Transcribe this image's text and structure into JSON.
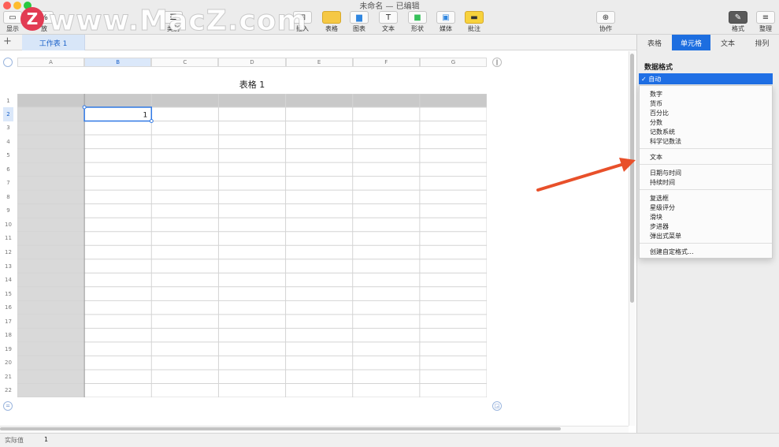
{
  "window": {
    "title": "未命名 — 已编辑"
  },
  "toolbar": {
    "left": [
      {
        "id": "view",
        "label": "显示"
      },
      {
        "id": "zoom",
        "label": "放",
        "value": "%"
      },
      {
        "id": "add-category",
        "label": "类别"
      }
    ],
    "center": [
      {
        "id": "insert",
        "label": "插入",
        "icon": "insert-icon"
      },
      {
        "id": "table",
        "label": "表格",
        "icon": "table-icon"
      },
      {
        "id": "chart",
        "label": "图表",
        "icon": "chart-icon"
      },
      {
        "id": "text",
        "label": "文本",
        "icon": "text-icon"
      },
      {
        "id": "shape",
        "label": "形状",
        "icon": "shape-icon"
      },
      {
        "id": "media",
        "label": "媒体",
        "icon": "media-icon"
      },
      {
        "id": "comment",
        "label": "批注",
        "icon": "comment-icon"
      }
    ],
    "collaborate": "协作",
    "format": "格式",
    "organize": "整理"
  },
  "watermark": {
    "logo_letter": "Z",
    "text": "www.MacZ.com"
  },
  "sheets": {
    "active": "工作表 1"
  },
  "table": {
    "title": "表格 1",
    "columns": [
      "A",
      "B",
      "C",
      "D",
      "E",
      "F",
      "G"
    ],
    "rows": [
      "1",
      "2",
      "3",
      "4",
      "5",
      "6",
      "7",
      "8",
      "9",
      "10",
      "11",
      "12",
      "13",
      "14",
      "15",
      "16",
      "17",
      "18",
      "19",
      "20",
      "21",
      "22"
    ],
    "selected_cell": {
      "col": "B",
      "row": "2",
      "value": "1"
    }
  },
  "inspector": {
    "tabs": [
      "表格",
      "单元格",
      "文本",
      "排列"
    ],
    "active_tab": "单元格",
    "section_title": "数据格式",
    "selected_format": "✓ 自动",
    "menu_groups": [
      [
        "数字",
        "货币",
        "百分比",
        "分数",
        "记数系统",
        "科学记数法"
      ],
      [
        "文本"
      ],
      [
        "日期与时间",
        "持续时间"
      ],
      [
        "复选框",
        "星级评分",
        "滑块",
        "步进器",
        "弹出式菜单"
      ],
      [
        "创建自定格式..."
      ]
    ]
  },
  "status": {
    "label": "实际值",
    "value": "1"
  },
  "colors": {
    "accent": "#1f6fe5",
    "arrow": "#e8502a",
    "header_fill": "#c9c9c9"
  }
}
